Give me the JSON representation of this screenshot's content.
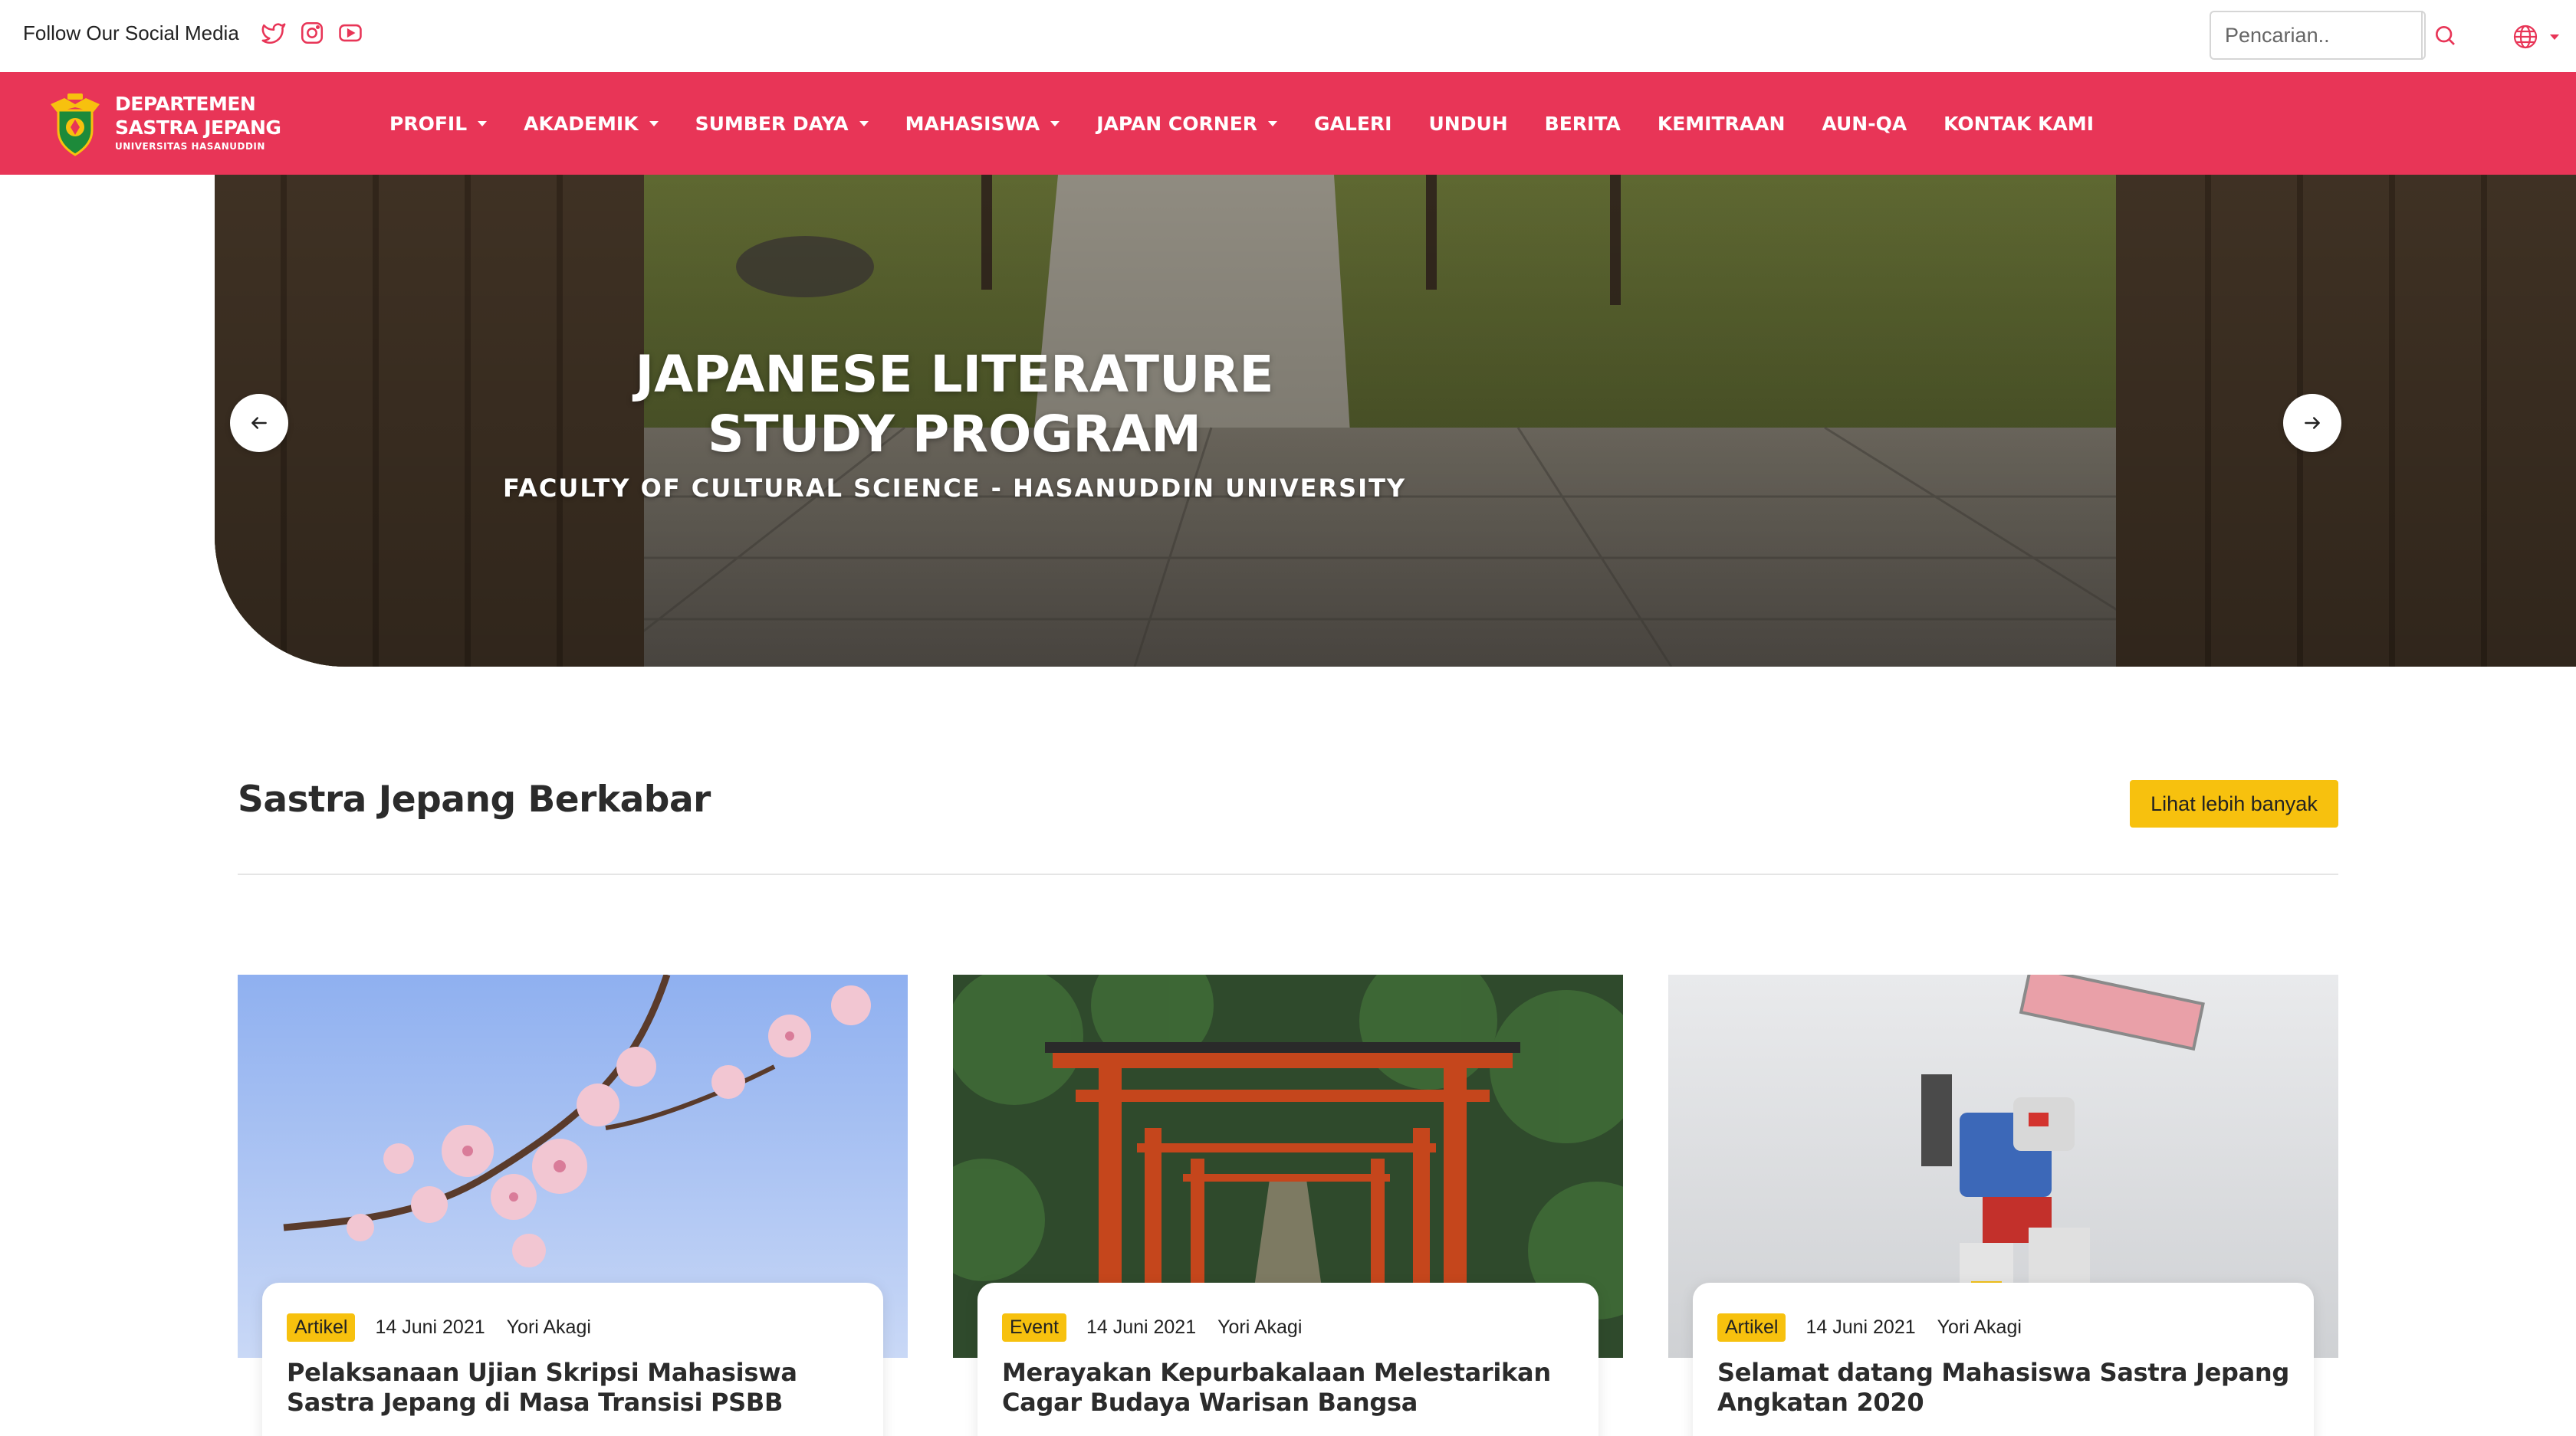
{
  "topbar": {
    "social_label": "Follow Our Social Media",
    "social_icons": [
      "twitter-icon",
      "instagram-icon",
      "youtube-icon"
    ],
    "search_placeholder": "Pencarian..",
    "language_icon": "globe-icon"
  },
  "brand": {
    "line1": "DEPARTEMEN",
    "line2": "SASTRA JEPANG",
    "line3": "UNIVERSITAS HASANUDDIN"
  },
  "nav": {
    "items": [
      {
        "label": "PROFIL",
        "dropdown": true
      },
      {
        "label": "AKADEMIK",
        "dropdown": true
      },
      {
        "label": "SUMBER DAYA",
        "dropdown": true
      },
      {
        "label": "MAHASISWA",
        "dropdown": true
      },
      {
        "label": "JAPAN CORNER",
        "dropdown": true
      },
      {
        "label": "GALERI",
        "dropdown": false
      },
      {
        "label": "UNDUH",
        "dropdown": false
      },
      {
        "label": "BERITA",
        "dropdown": false
      },
      {
        "label": "KEMITRAAN",
        "dropdown": false
      },
      {
        "label": "AUN-QA",
        "dropdown": false
      },
      {
        "label": "KONTAK KAMI",
        "dropdown": false
      }
    ]
  },
  "hero": {
    "title_line1": "JAPANESE LITERATURE",
    "title_line2": "STUDY PROGRAM",
    "subtitle": "FACULTY OF CULTURAL SCIENCE - HASANUDDIN UNIVERSITY"
  },
  "news": {
    "title": "Sastra Jepang Berkabar",
    "more_label": "Lihat lebih banyak",
    "cards": [
      {
        "category": "Artikel",
        "date": "14 Juni 2021",
        "author": "Yori Akagi",
        "title": "Pelaksanaan Ujian Skripsi Mahasiswa Sastra Jepang di Masa Transisi PSBB"
      },
      {
        "category": "Event",
        "date": "14 Juni 2021",
        "author": "Yori Akagi",
        "title": "Merayakan Kepurbakalaan Melestarikan Cagar Budaya Warisan Bangsa"
      },
      {
        "category": "Artikel",
        "date": "14 Juni 2021",
        "author": "Yori Akagi",
        "title": "Selamat datang Mahasiswa Sastra Jepang Angkatan 2020"
      }
    ]
  },
  "colors": {
    "brand_red": "#e83557",
    "accent_yellow": "#f7c10e"
  }
}
